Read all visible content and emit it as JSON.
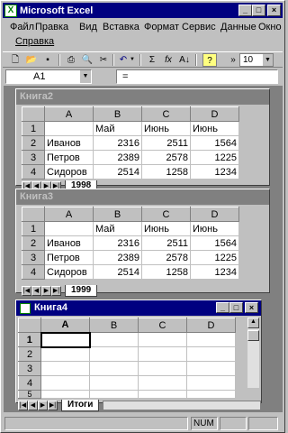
{
  "window": {
    "title": "Microsoft Excel",
    "app_icon": "X"
  },
  "menu": {
    "items": [
      "Файл",
      "Правка",
      "Вид",
      "Вставка",
      "Формат",
      "Сервис",
      "Данные",
      "Окно",
      "Справка"
    ]
  },
  "toolbar": {
    "zoom": "10",
    "overflow": "»"
  },
  "formula_bar": {
    "cell_ref": "A1",
    "equals": "="
  },
  "workbooks": [
    {
      "title": "Книга2",
      "active": false,
      "columns": [
        "",
        "A",
        "B",
        "C",
        "D"
      ],
      "rows": [
        {
          "n": "1",
          "a": "",
          "b": "Май",
          "c": "Июнь",
          "d": "Июнь"
        },
        {
          "n": "2",
          "a": "Иванов",
          "b": "2316",
          "c": "2511",
          "d": "1564"
        },
        {
          "n": "3",
          "a": "Петров",
          "b": "2389",
          "c": "2578",
          "d": "1225"
        },
        {
          "n": "4",
          "a": "Сидоров",
          "b": "2514",
          "c": "1258",
          "d": "1234"
        }
      ],
      "sheet_tab": "1998"
    },
    {
      "title": "Книга3",
      "active": false,
      "columns": [
        "",
        "A",
        "B",
        "C",
        "D"
      ],
      "rows": [
        {
          "n": "1",
          "a": "",
          "b": "Май",
          "c": "Июнь",
          "d": "Июнь"
        },
        {
          "n": "2",
          "a": "Иванов",
          "b": "2316",
          "c": "2511",
          "d": "1564"
        },
        {
          "n": "3",
          "a": "Петров",
          "b": "2389",
          "c": "2578",
          "d": "1225"
        },
        {
          "n": "4",
          "a": "Сидоров",
          "b": "2514",
          "c": "1258",
          "d": "1234"
        }
      ],
      "sheet_tab": "1999"
    },
    {
      "title": "Книга4",
      "active": true,
      "columns": [
        "",
        "A",
        "B",
        "C",
        "D"
      ],
      "rows": [
        {
          "n": "1",
          "a": "",
          "b": "",
          "c": "",
          "d": ""
        },
        {
          "n": "2",
          "a": "",
          "b": "",
          "c": "",
          "d": ""
        },
        {
          "n": "3",
          "a": "",
          "b": "",
          "c": "",
          "d": ""
        },
        {
          "n": "4",
          "a": "",
          "b": "",
          "c": "",
          "d": ""
        },
        {
          "n": "5",
          "a": "",
          "b": "",
          "c": "",
          "d": ""
        }
      ],
      "sheet_tab": "Итоги"
    }
  ],
  "status": {
    "num": "NUM"
  }
}
